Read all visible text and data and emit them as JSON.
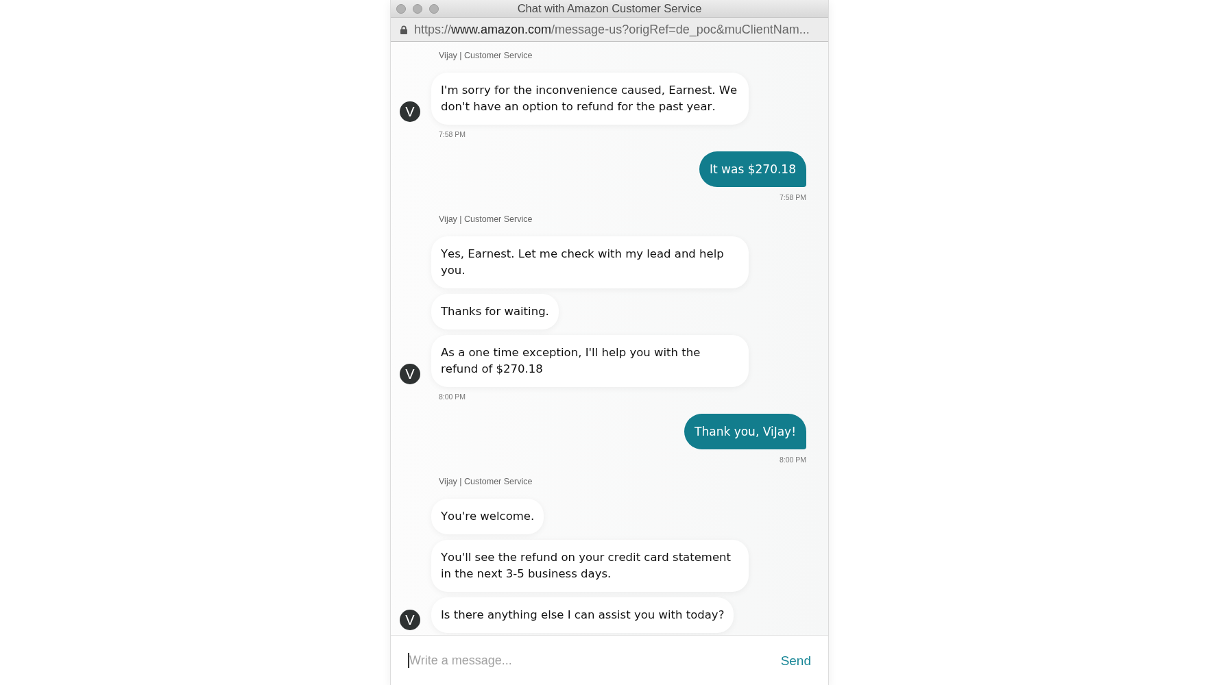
{
  "window": {
    "title": "Chat with Amazon Customer Service"
  },
  "address_bar": {
    "scheme": "https://",
    "host": "www.amazon.com",
    "path": "/message-us?origRef=de_poc&muClientNam..."
  },
  "messages": [
    {
      "kind": "agent",
      "sender": "Vijay | Customer Service",
      "avatar": "V",
      "bubbles": [
        "I'm sorry for the inconvenience caused, Earnest. We don't have an option to refund for the past year."
      ],
      "time": "7:58 PM"
    },
    {
      "kind": "user",
      "bubbles": [
        "It was $270.18"
      ],
      "time": "7:58 PM"
    },
    {
      "kind": "agent",
      "sender": "Vijay | Customer Service",
      "avatar": "V",
      "bubbles": [
        "Yes, Earnest. Let me check with my lead and help you.",
        "Thanks for waiting.",
        "As a one time exception, I'll help you with the refund of $270.18"
      ],
      "time": "8:00 PM"
    },
    {
      "kind": "user",
      "bubbles": [
        "Thank you, ViJay!"
      ],
      "time": "8:00 PM"
    },
    {
      "kind": "agent",
      "sender": "Vijay | Customer Service",
      "avatar": "V",
      "bubbles": [
        "You're welcome.",
        "You'll see the refund on your credit card statement in the next 3-5 business days.",
        "Is there anything else I can assist you with today?"
      ]
    }
  ],
  "composer": {
    "placeholder": "Write a message...",
    "focused": true,
    "send": "Send"
  }
}
